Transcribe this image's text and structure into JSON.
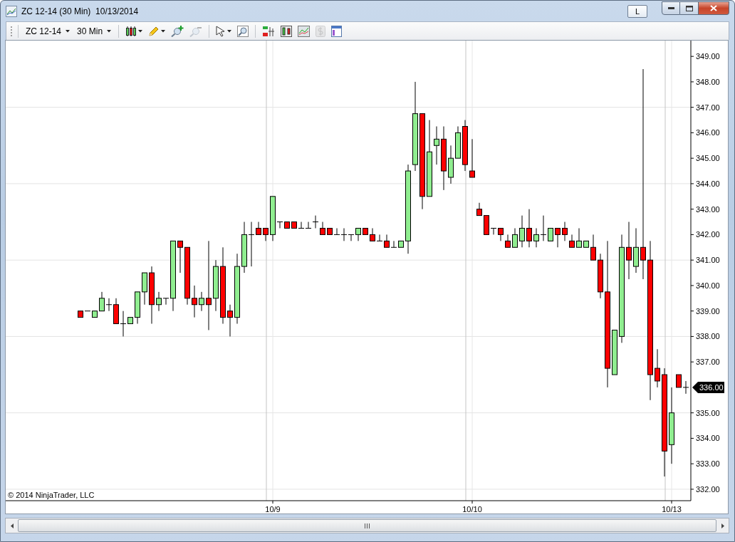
{
  "window": {
    "title": "ZC 12-14 (30 Min)  10/13/2014",
    "link_button": "L"
  },
  "toolbar": {
    "instrument": "ZC 12-14",
    "interval": "30 Min",
    "tools": [
      {
        "kind": "chart-style",
        "disabled": false
      },
      {
        "kind": "draw",
        "disabled": false
      },
      {
        "kind": "zoom-in",
        "disabled": false
      },
      {
        "kind": "zoom-out",
        "disabled": true
      },
      {
        "kind": "cursor",
        "disabled": false
      },
      {
        "kind": "magnify",
        "disabled": false
      },
      {
        "kind": "strategies",
        "disabled": false
      },
      {
        "kind": "indicators",
        "disabled": false
      },
      {
        "kind": "data-box",
        "disabled": false
      },
      {
        "kind": "price",
        "disabled": true
      },
      {
        "kind": "properties",
        "disabled": false
      }
    ]
  },
  "chart": {
    "copyright": "© 2014 NinjaTrader, LLC",
    "last_price": "336.00",
    "chart_data": {
      "type": "candlestick",
      "grid": true,
      "categories": [
        null,
        null,
        null,
        null,
        null,
        null,
        null,
        null,
        null,
        null,
        null,
        null,
        null,
        null,
        null,
        null,
        null,
        null,
        null,
        null,
        null,
        null,
        null,
        null,
        null,
        null,
        null,
        "10/9",
        null,
        null,
        null,
        null,
        null,
        null,
        null,
        null,
        null,
        null,
        null,
        null,
        null,
        null,
        null,
        null,
        null,
        null,
        null,
        null,
        null,
        null,
        null,
        null,
        null,
        null,
        null,
        "10/10",
        null,
        null,
        null,
        null,
        null,
        null,
        null,
        null,
        null,
        null,
        null,
        null,
        null,
        null,
        null,
        null,
        null,
        null,
        null,
        null,
        null,
        null,
        null,
        null,
        null,
        null,
        null,
        "10/13",
        null,
        null
      ],
      "yticks": [
        {
          "value": 349,
          "label": "349.00"
        },
        {
          "value": 348,
          "label": "348.00"
        },
        {
          "value": 347,
          "label": "347.00"
        },
        {
          "value": 346,
          "label": "346.00"
        },
        {
          "value": 345,
          "label": "345.00"
        },
        {
          "value": 344,
          "label": "344.00"
        },
        {
          "value": 343,
          "label": "343.00"
        },
        {
          "value": 342,
          "label": "342.00"
        },
        {
          "value": 341,
          "label": "341.00"
        },
        {
          "value": 340,
          "label": "340.00"
        },
        {
          "value": 339,
          "label": "339.00"
        },
        {
          "value": 338,
          "label": "338.00"
        },
        {
          "value": 337,
          "label": "337.00"
        },
        {
          "value": 335,
          "label": "335.00"
        },
        {
          "value": 334,
          "label": "334.00"
        },
        {
          "value": 333,
          "label": "333.00"
        },
        {
          "value": 332,
          "label": "332.00"
        }
      ],
      "ylim": [
        331.55,
        349.62
      ],
      "ohlc": [
        [
          339,
          339,
          338.75,
          338.75
        ],
        [
          339,
          339,
          339,
          339
        ],
        [
          338.75,
          339,
          338.75,
          339
        ],
        [
          339,
          339.75,
          339,
          339.5
        ],
        [
          339.25,
          339.5,
          339,
          339.25
        ],
        [
          339.25,
          339.5,
          338.5,
          338.5
        ],
        [
          338.5,
          339,
          338,
          338.5
        ],
        [
          338.5,
          338.75,
          338.5,
          338.75
        ],
        [
          338.75,
          339.75,
          338.5,
          339.75
        ],
        [
          339.75,
          340.5,
          339.25,
          340.5
        ],
        [
          340.5,
          340.75,
          338.5,
          339.25
        ],
        [
          339.25,
          339.75,
          339,
          339.5
        ],
        [
          339.5,
          339.5,
          339.25,
          339.5
        ],
        [
          339.5,
          341.75,
          339,
          341.75
        ],
        [
          341.75,
          341.75,
          340.5,
          341.5
        ],
        [
          341.5,
          341.5,
          339.25,
          339.5
        ],
        [
          339.5,
          340,
          338.75,
          339.25
        ],
        [
          339.25,
          339.75,
          339,
          339.5
        ],
        [
          339.5,
          341.75,
          338.25,
          339.25
        ],
        [
          339.5,
          341,
          339,
          340.75
        ],
        [
          340.75,
          341.5,
          338.5,
          338.75
        ],
        [
          339,
          339.25,
          338,
          338.75
        ],
        [
          338.75,
          341.25,
          338.5,
          340.75
        ],
        [
          340.75,
          342.5,
          340.5,
          342
        ],
        [
          342,
          342.5,
          340.75,
          342
        ],
        [
          342.25,
          342.5,
          342,
          342
        ],
        [
          342.25,
          342.25,
          341.75,
          342
        ],
        [
          342,
          343.5,
          341.75,
          343.5
        ],
        [
          342.5,
          342.5,
          342.25,
          342.5
        ],
        [
          342.5,
          342.5,
          342.25,
          342.25
        ],
        [
          342.5,
          342.5,
          342.25,
          342.25
        ],
        [
          342.25,
          342.5,
          342.25,
          342.25
        ],
        [
          342.25,
          342.5,
          342.25,
          342.25
        ],
        [
          342.5,
          342.75,
          342.25,
          342.5
        ],
        [
          342.25,
          342.5,
          342,
          342
        ],
        [
          342.25,
          342.25,
          342,
          342
        ],
        [
          342,
          342.25,
          342,
          342
        ],
        [
          342,
          342.25,
          341.75,
          342
        ],
        [
          342,
          342,
          341.75,
          342
        ],
        [
          342,
          342.25,
          341.75,
          342.25
        ],
        [
          342.25,
          342.25,
          342,
          342
        ],
        [
          342,
          342.25,
          341.75,
          341.75
        ],
        [
          341.75,
          342,
          341.75,
          341.75
        ],
        [
          341.75,
          342,
          341.5,
          341.5
        ],
        [
          341.5,
          341.75,
          341.5,
          341.5
        ],
        [
          341.5,
          341.75,
          341.5,
          341.75
        ],
        [
          341.75,
          344.75,
          341.25,
          344.5
        ],
        [
          344.75,
          348,
          344.5,
          346.75
        ],
        [
          346.75,
          346.75,
          343,
          343.5
        ],
        [
          343.5,
          346.5,
          343.5,
          345.25
        ],
        [
          345.5,
          346.25,
          344.75,
          345.75
        ],
        [
          345.75,
          346.25,
          343.75,
          344.5
        ],
        [
          344.25,
          345.5,
          344,
          345
        ],
        [
          345,
          346.25,
          345,
          346
        ],
        [
          346.25,
          346.5,
          344.5,
          344.75
        ],
        [
          344.5,
          345.75,
          344.25,
          344.25
        ],
        [
          343,
          343.25,
          342.75,
          342.75
        ],
        [
          342.75,
          342.75,
          342,
          342
        ],
        [
          342.25,
          342.25,
          342,
          342.25
        ],
        [
          342.25,
          342.25,
          341.75,
          342
        ],
        [
          341.75,
          342,
          341.5,
          341.5
        ],
        [
          341.5,
          342.25,
          341.5,
          342
        ],
        [
          341.75,
          342.75,
          341.5,
          342.25
        ],
        [
          342.25,
          343,
          341.5,
          341.75
        ],
        [
          341.75,
          342.25,
          341.5,
          342
        ],
        [
          342,
          342.75,
          341.75,
          342
        ],
        [
          341.75,
          342.25,
          341.75,
          342.25
        ],
        [
          342.25,
          342.25,
          341.5,
          342
        ],
        [
          342.25,
          342.5,
          341.75,
          342
        ],
        [
          341.75,
          342,
          341.5,
          341.5
        ],
        [
          341.5,
          342.25,
          341.5,
          341.75
        ],
        [
          341.5,
          341.75,
          341.5,
          341.75
        ],
        [
          341.5,
          342,
          341,
          341
        ],
        [
          341,
          341.25,
          339.5,
          339.75
        ],
        [
          339.75,
          341.75,
          336,
          336.75
        ],
        [
          336.5,
          338.25,
          336.5,
          338.25
        ],
        [
          338,
          342,
          337.75,
          341.5
        ],
        [
          341.5,
          342.5,
          340.25,
          341
        ],
        [
          340.75,
          342.25,
          340.5,
          341.5
        ],
        [
          341.5,
          348.5,
          340.25,
          341
        ],
        [
          341,
          341.75,
          335.5,
          336.5
        ],
        [
          336.75,
          337.5,
          336,
          336.25
        ],
        [
          336.5,
          336.75,
          332.5,
          333.5
        ],
        [
          333.75,
          336,
          333,
          335
        ],
        [
          336.5,
          336.5,
          336,
          336
        ],
        [
          336,
          336.25,
          335.75,
          336
        ]
      ]
    }
  }
}
